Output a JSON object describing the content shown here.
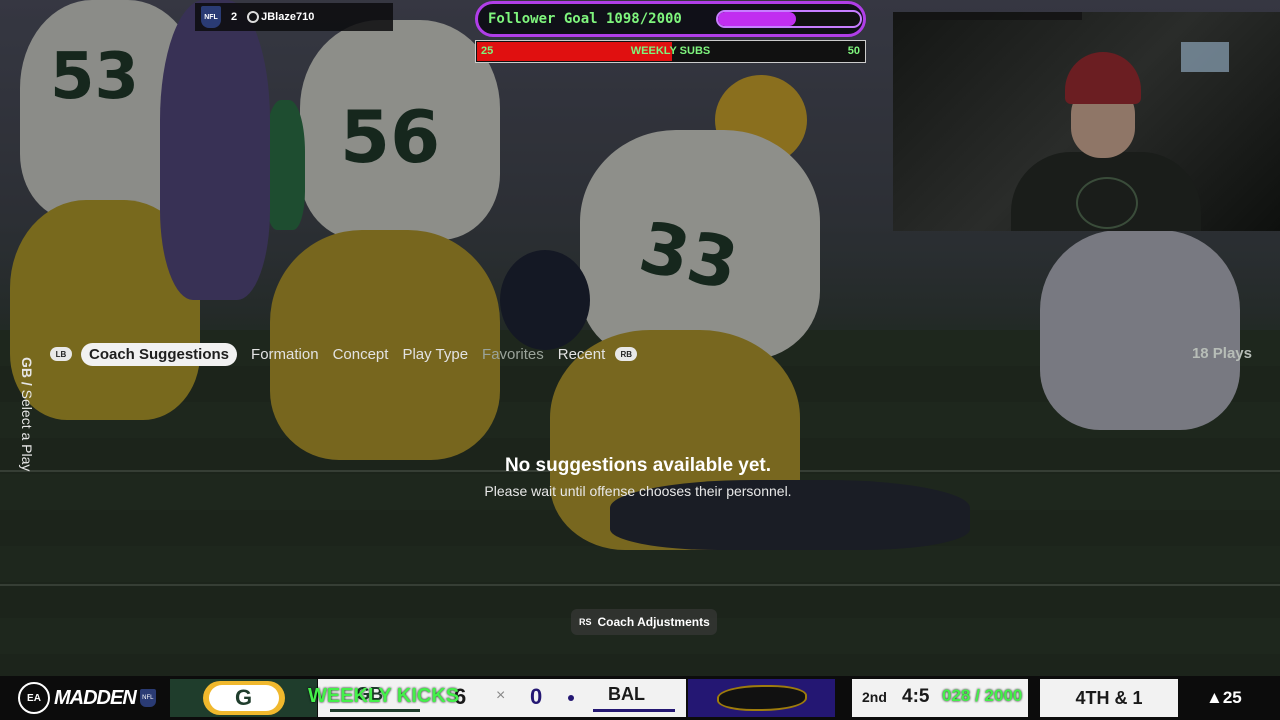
{
  "overlay": {
    "top_left": {
      "rank": "2",
      "gamertag": "JBlaze710"
    },
    "follower_goal": {
      "label": "Follower Goal 1098/2000",
      "progress": 0.549
    },
    "weekly_subs": {
      "title": "WEEKLY SUBS",
      "current": "25",
      "goal": "50",
      "progress": 0.5
    },
    "weekly_kicks": "WEEKLY KICKS",
    "kicks_overlay_value": "028 / 2000"
  },
  "menu": {
    "side_label_team": "GB",
    "side_label_sep": " / ",
    "side_label_text": "Select a Play",
    "lb_button": "LB",
    "rb_button": "RB",
    "tabs": [
      {
        "label": "Coach Suggestions",
        "active": true
      },
      {
        "label": "Formation"
      },
      {
        "label": "Concept"
      },
      {
        "label": "Play Type"
      },
      {
        "label": "Favorites",
        "dim": true
      },
      {
        "label": "Recent"
      }
    ],
    "play_count": "18 Plays",
    "empty_title": "No suggestions available yet.",
    "empty_subtitle": "Please wait until offense chooses their personnel.",
    "coach_adjust_button": "RS",
    "coach_adjust_label": "Coach Adjustments"
  },
  "scene": {
    "jersey_numbers": [
      "53",
      "56",
      "33"
    ]
  },
  "scorebug": {
    "brand": "MADDEN",
    "ea": "EA",
    "nfl": "NFL",
    "home_logo": "G",
    "home_abbr": "GB",
    "home_score": "6",
    "vs": "×",
    "away_score": "0",
    "away_abbr": "BAL",
    "quarter": "2nd",
    "clock": "4:5",
    "down_distance": "4TH & 1",
    "play_clock": "▲25"
  },
  "colors": {
    "packers_green": "#1f3d2c",
    "packers_gold": "#f0b82d",
    "ravens_purple": "#241773",
    "overlay_green": "#7ff57d",
    "goal_purple": "#c12ef0",
    "subs_red": "#e01010"
  }
}
